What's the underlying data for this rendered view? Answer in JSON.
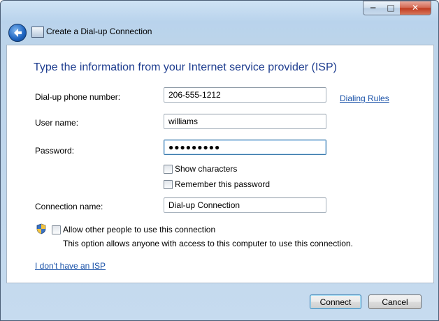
{
  "window": {
    "title": "Create a Dial-up Connection",
    "controls": {
      "minimize": "−",
      "maximize": "□",
      "close": "✕"
    }
  },
  "page": {
    "heading": "Type the information from your Internet service provider (ISP)",
    "phone_label": "Dial-up phone number:",
    "phone_value": "206-555-1212",
    "dialing_rules_link": "Dialing Rules",
    "username_label": "User name:",
    "username_value": "williams",
    "password_label": "Password:",
    "password_value": "●●●●●●●●●",
    "show_characters_label": "Show characters",
    "show_characters_checked": false,
    "remember_password_label": "Remember this password",
    "remember_password_checked": false,
    "connection_name_label": "Connection name:",
    "connection_name_value": "Dial-up Connection",
    "allow_others_label": "Allow other people to use this connection",
    "allow_others_checked": false,
    "allow_others_desc": "This option allows anyone with access to this computer to use this connection.",
    "no_isp_link": "I don't have an ISP"
  },
  "footer": {
    "connect_label": "Connect",
    "cancel_label": "Cancel"
  }
}
